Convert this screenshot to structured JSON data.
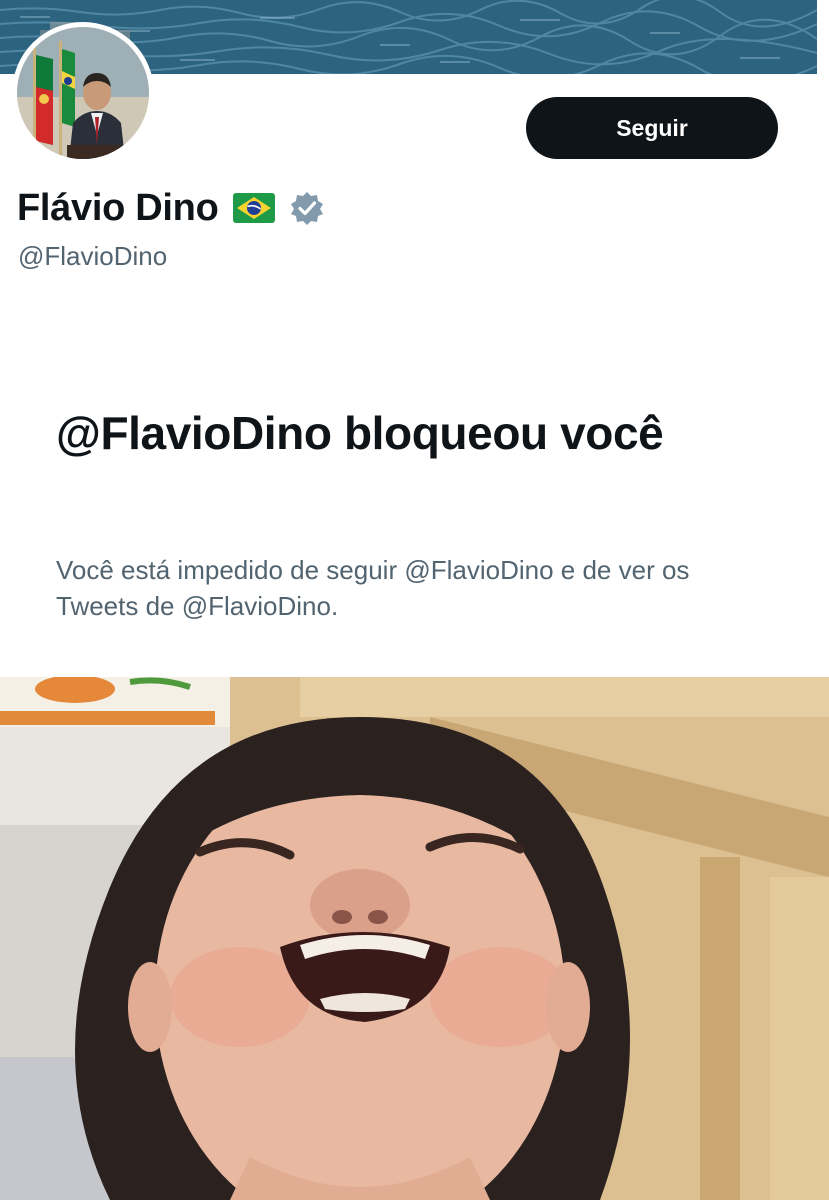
{
  "profile": {
    "display_name": "Flávio Dino",
    "flag_icon": "brazil-flag-icon",
    "verified_icon": "verified-badge-icon",
    "handle": "@FlavioDino",
    "follow_label": "Seguir"
  },
  "blocked": {
    "title": "@FlavioDino bloqueou você",
    "description": "Você está impedido de seguir @FlavioDino e de ver os Tweets de @FlavioDino."
  },
  "colors": {
    "button_bg": "#0f1419",
    "text_primary": "#0f1419",
    "text_secondary": "#536471",
    "verified_gray": "#829aab"
  }
}
